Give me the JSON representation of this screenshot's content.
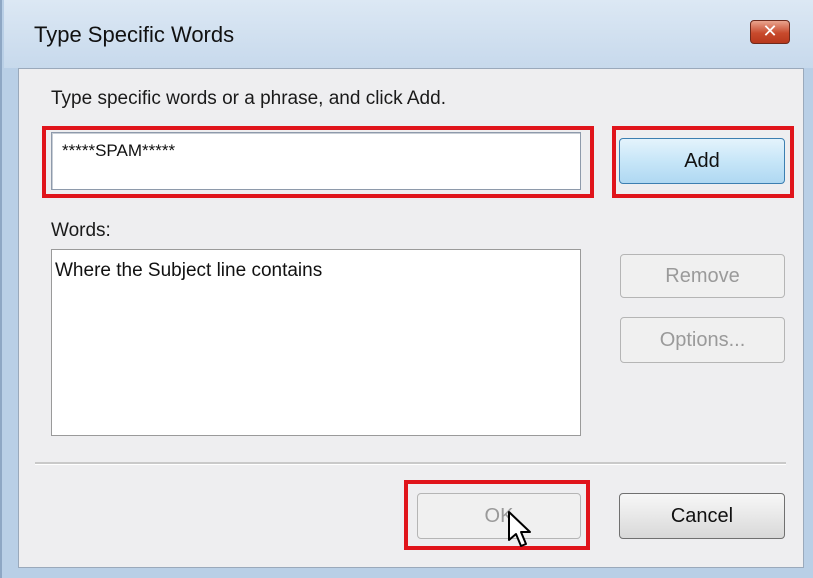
{
  "window": {
    "title": "Type Specific Words",
    "close_glyph": "✕"
  },
  "dialog": {
    "prompt": "Type specific words or a phrase, and click Add.",
    "word_input_value": "*****SPAM*****",
    "words_label": "Words:",
    "words_list": [
      "Where the Subject line contains"
    ]
  },
  "buttons": {
    "add": "Add",
    "remove": "Remove",
    "options": "Options...",
    "ok": "OK",
    "cancel": "Cancel"
  },
  "highlight_color": "#e0141b",
  "cursor_icon": "arrow-pointer-icon"
}
